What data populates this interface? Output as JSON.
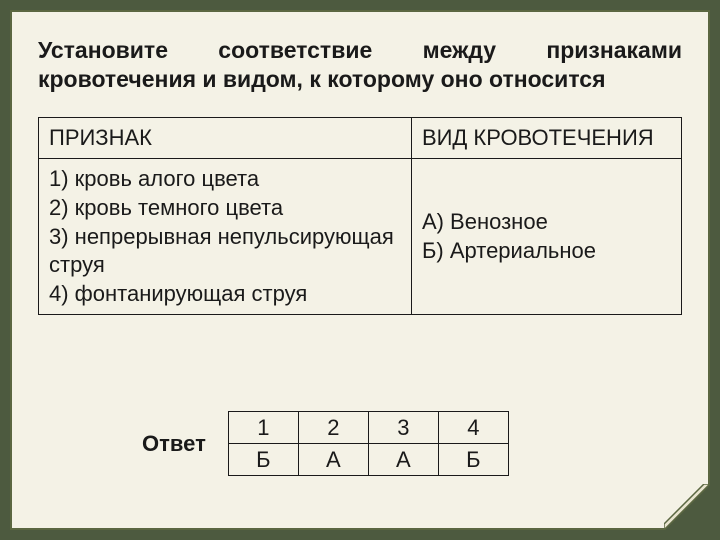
{
  "heading_line1": "Установите соответствие между признаками",
  "heading_line2": "кровотечения и видом, к которому оно относится",
  "table": {
    "header_left": "ПРИЗНАК",
    "header_right": "ВИД КРОВОТЕЧЕНИЯ",
    "items_left": "1) кровь алого цвета\n2) кровь темного цвета\n3) непрерывная непульсирующая струя\n4) фонтанирующая струя",
    "items_right": "А) Венозное\nБ) Артериальное"
  },
  "answer": {
    "label": "Ответ",
    "cols": [
      "1",
      "2",
      "3",
      "4"
    ],
    "vals": [
      "Б",
      "А",
      "А",
      "Б"
    ]
  }
}
